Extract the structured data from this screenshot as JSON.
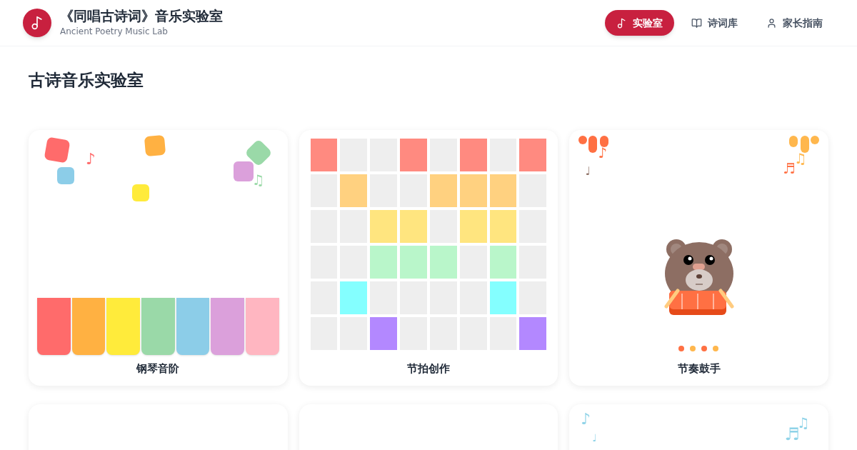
{
  "header": {
    "title": "《同唱古诗词》音乐实验室",
    "subtitle": "Ancient Poetry Music Lab"
  },
  "nav": [
    {
      "label": "实验室",
      "selected": true
    },
    {
      "label": "诗词库",
      "selected": false
    },
    {
      "label": "家长指南",
      "selected": false
    }
  ],
  "page_title": "古诗音乐实验室",
  "cards": [
    {
      "kind": "piano",
      "title": "钢琴音阶",
      "keys": [
        {
          "color": "#ff6b6b"
        },
        {
          "color": "#ffb142"
        },
        {
          "color": "#ffeb3b"
        },
        {
          "color": "#9ad9a8"
        },
        {
          "color": "#8ccde8"
        },
        {
          "color": "#dba0db"
        },
        {
          "color": "#ffb6c1"
        }
      ],
      "notes": [
        {
          "text": "♪",
          "color": "#ff6b6b"
        },
        {
          "text": "♫",
          "color": "#9ad9a8"
        }
      ]
    },
    {
      "kind": "beat",
      "title": "节拍创作",
      "grid": [
        {
          "color": "#ff8a80",
          "cells": [
            true,
            false,
            false,
            true,
            false,
            true,
            false,
            true
          ]
        },
        {
          "color": "#ffd180",
          "cells": [
            false,
            true,
            false,
            false,
            true,
            true,
            true,
            false
          ]
        },
        {
          "color": "#ffe57f",
          "cells": [
            false,
            false,
            true,
            true,
            false,
            true,
            true,
            false
          ]
        },
        {
          "color": "#b9f6ca",
          "cells": [
            false,
            false,
            true,
            true,
            true,
            false,
            true,
            false
          ]
        },
        {
          "color": "#84ffff",
          "cells": [
            false,
            true,
            false,
            false,
            false,
            false,
            true,
            false
          ]
        },
        {
          "color": "#b388ff",
          "cells": [
            false,
            false,
            true,
            false,
            false,
            false,
            false,
            true
          ]
        }
      ]
    },
    {
      "kind": "drum",
      "title": "节奏鼓手",
      "notes": [
        {
          "text": "♪",
          "color": "#ff7043"
        },
        {
          "text": "♩",
          "color": "#8d6e63"
        },
        {
          "text": "♫",
          "color": "#ffb74d"
        },
        {
          "text": "♬",
          "color": "#ff7043"
        }
      ]
    }
  ],
  "lower_cards": [
    {
      "kind": "blank"
    },
    {
      "kind": "blank"
    },
    {
      "kind": "notes",
      "notes": [
        {
          "text": "♪",
          "color": "#8fd3e8"
        },
        {
          "text": "♩",
          "color": "#8fd3e8"
        },
        {
          "text": "♫",
          "color": "#8fd3e8"
        },
        {
          "text": "♬",
          "color": "#8fd3e8"
        }
      ]
    }
  ]
}
